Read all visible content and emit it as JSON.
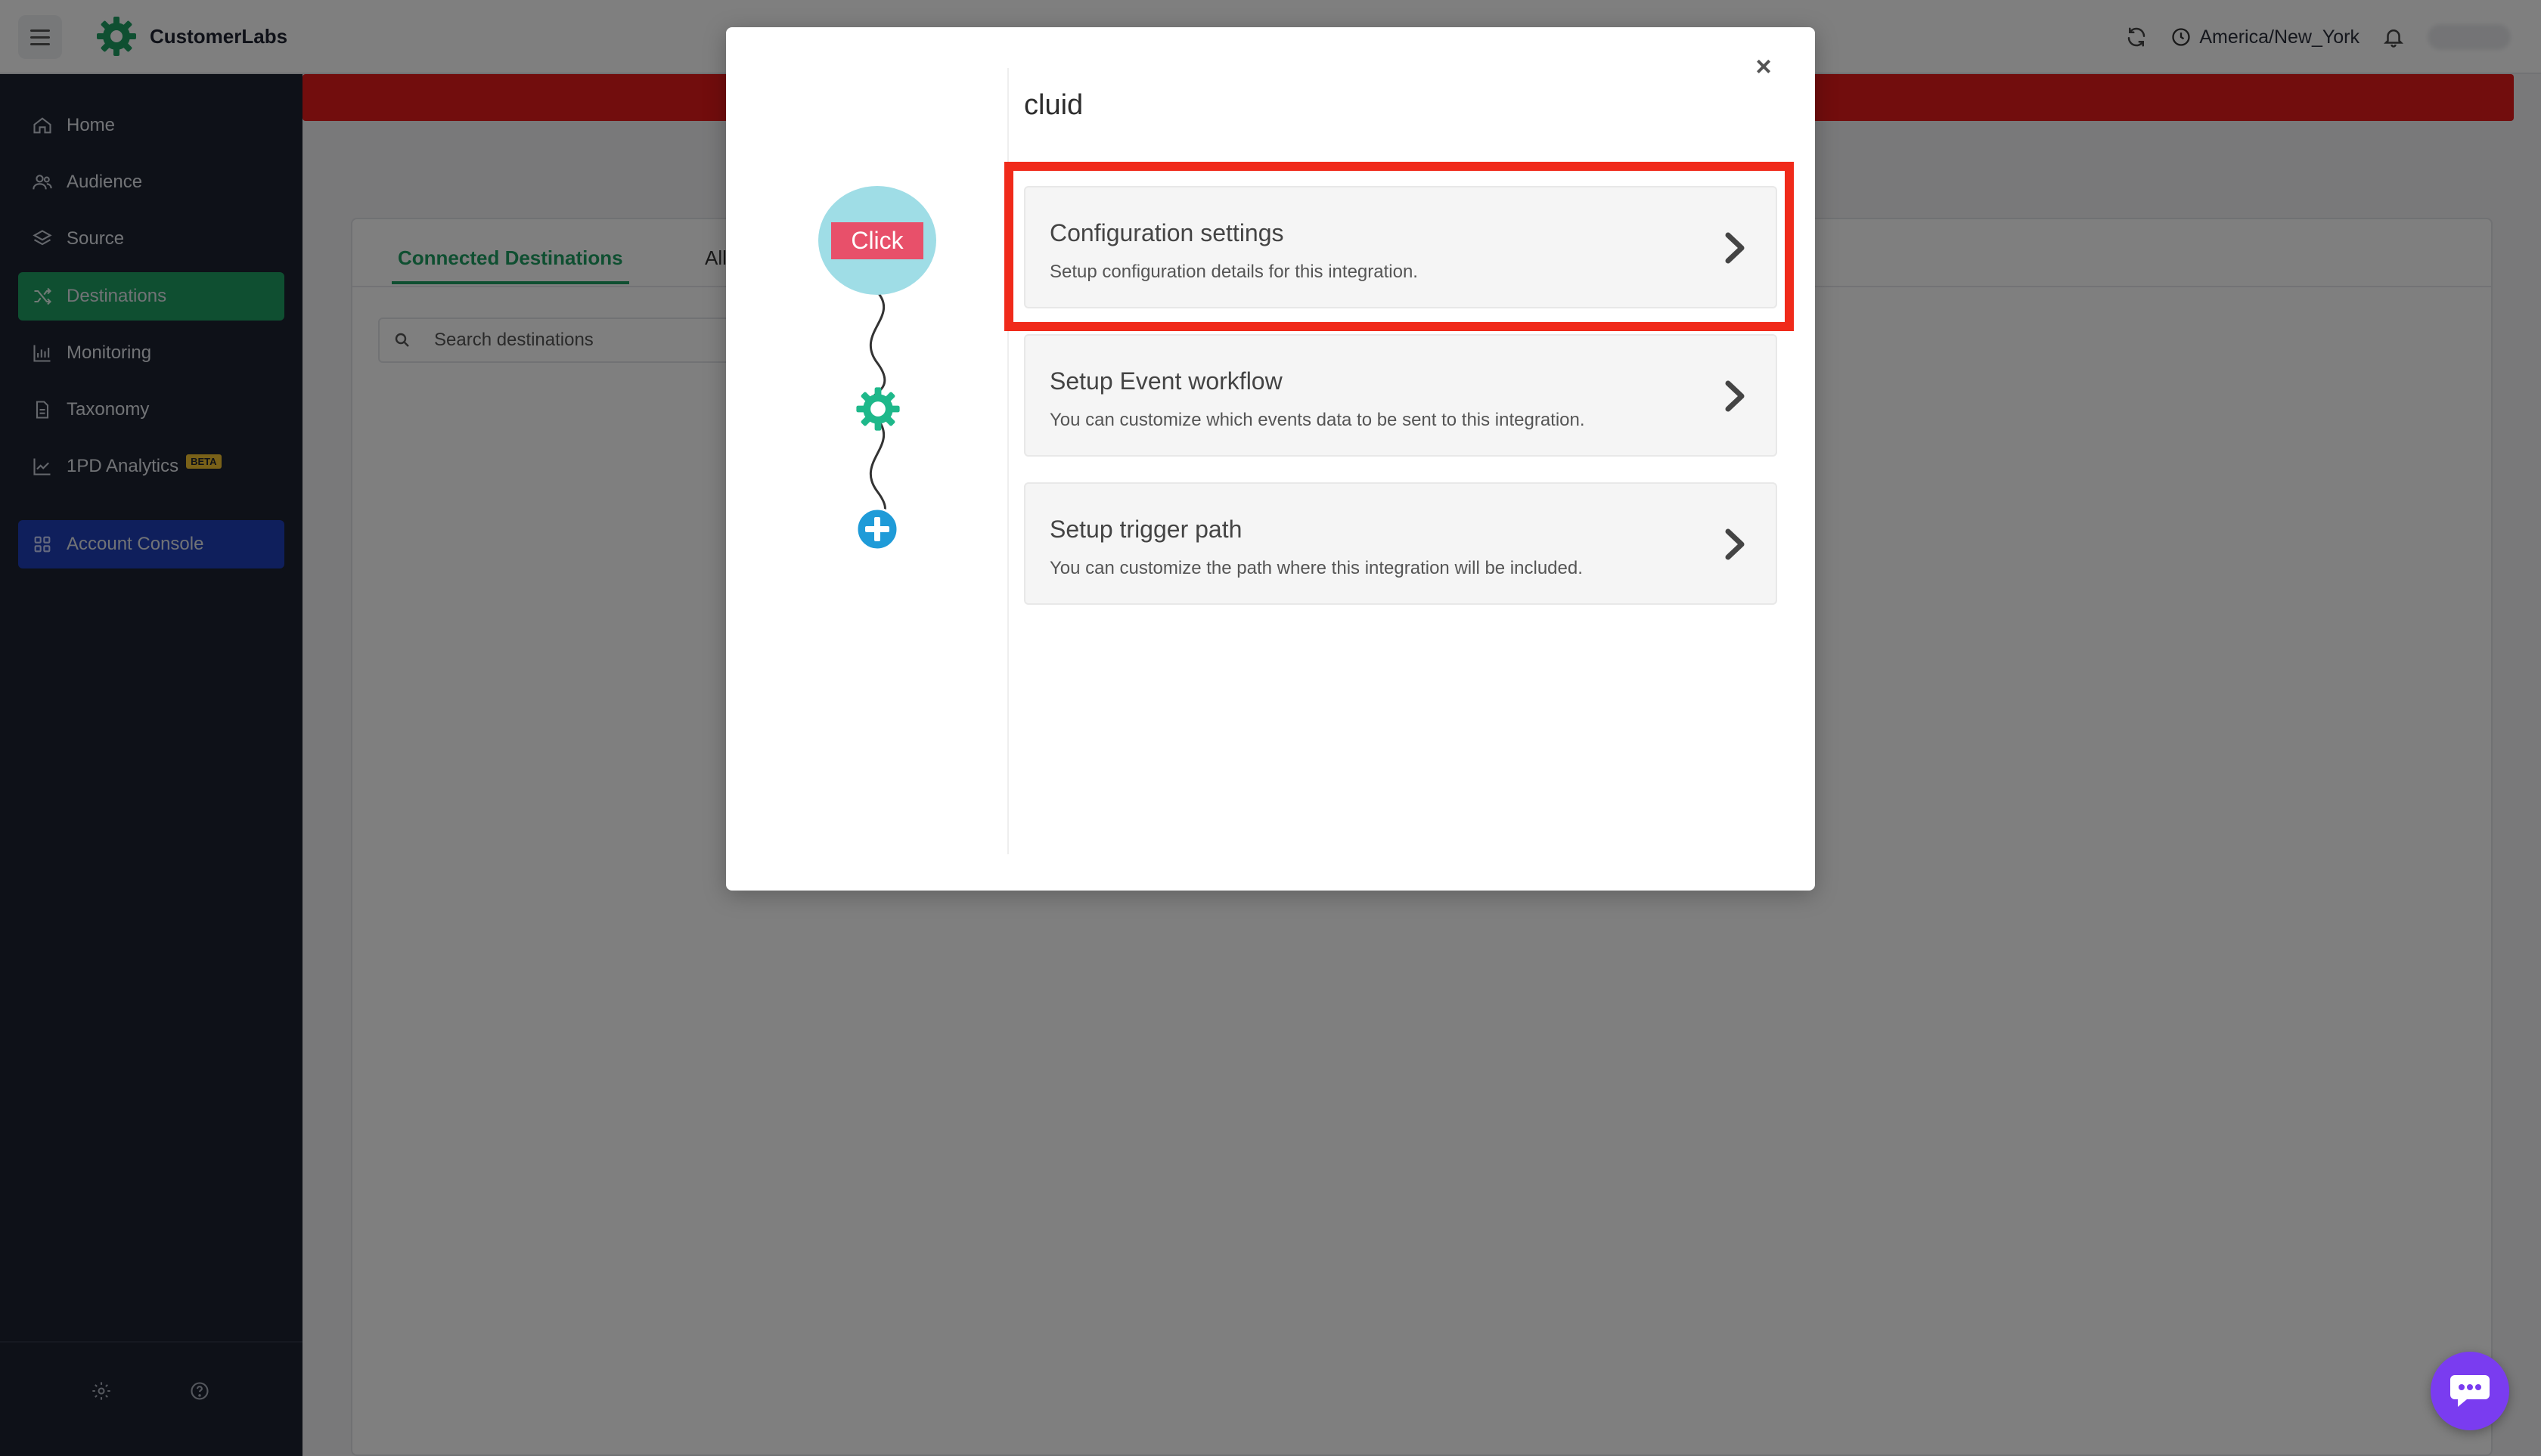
{
  "app": {
    "brand_name": "CustomerLabs"
  },
  "topbar": {
    "timezone": "America/New_York"
  },
  "sidebar": {
    "items": [
      {
        "label": "Home",
        "icon": "home-icon"
      },
      {
        "label": "Audience",
        "icon": "users-icon"
      },
      {
        "label": "Source",
        "icon": "layers-icon"
      },
      {
        "label": "Destinations",
        "icon": "shuffle-icon",
        "active": true
      },
      {
        "label": "Monitoring",
        "icon": "bar-chart-icon"
      },
      {
        "label": "Taxonomy",
        "icon": "document-icon"
      },
      {
        "label": "1PD Analytics",
        "icon": "trend-icon",
        "badge": "BETA"
      },
      {
        "label": "Account Console",
        "icon": "grid-icon"
      }
    ]
  },
  "main": {
    "tabs": [
      {
        "label": "Connected Destinations",
        "active": true
      },
      {
        "label": "All"
      }
    ],
    "search": {
      "placeholder": "Search destinations"
    }
  },
  "modal": {
    "title": "cluid",
    "flow_label": "Click",
    "options": [
      {
        "title": "Configuration settings",
        "desc": "Setup configuration details for this integration.",
        "highlighted": true
      },
      {
        "title": "Setup Event workflow",
        "desc": "You can customize which events data to be sent to this integration."
      },
      {
        "title": "Setup trigger path",
        "desc": "You can customize the path where this integration will be included."
      }
    ]
  },
  "colors": {
    "sidebar_bg": "#1d2230",
    "active_green": "#1e9e63",
    "console_blue": "#1f3eb8",
    "alert_red": "#e51a1a",
    "highlight_red": "#f02a1a",
    "chat_purple": "#7a3cf0",
    "flow_bubble": "#9fdde6",
    "click_label": "#e8506a"
  }
}
